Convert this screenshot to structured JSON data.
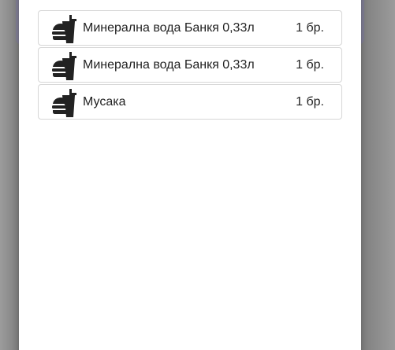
{
  "order_list": {
    "items": [
      {
        "name": "Минерална вода Банкя 0,33л",
        "qty": "1 бр.",
        "icon": "food-and-drink-icon"
      },
      {
        "name": "Минерална вода Банкя 0,33л",
        "qty": "1 бр.",
        "icon": "food-and-drink-icon"
      },
      {
        "name": "Мусака",
        "qty": "1 бр.",
        "icon": "food-and-drink-icon"
      }
    ]
  },
  "colors": {
    "overlay": "#7f7f7f",
    "underlay_card": "#7f7d93",
    "modal_bg": "#ffffff",
    "item_border": "#d6d6d6",
    "text": "#222222",
    "icon": "#222222"
  }
}
